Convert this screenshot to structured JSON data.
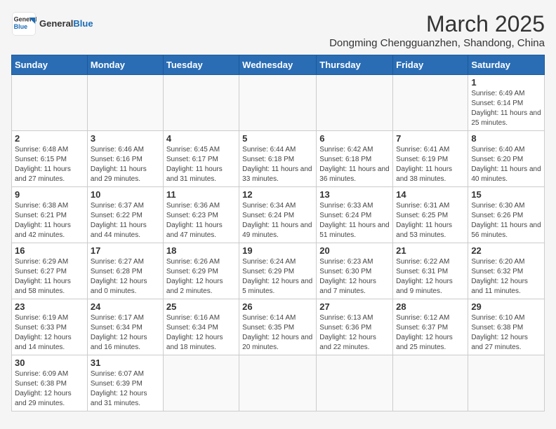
{
  "logo": {
    "line1": "General",
    "line2": "Blue"
  },
  "title": "March 2025",
  "location": "Dongming Chengguanzhen, Shandong, China",
  "headers": [
    "Sunday",
    "Monday",
    "Tuesday",
    "Wednesday",
    "Thursday",
    "Friday",
    "Saturday"
  ],
  "weeks": [
    [
      {
        "day": "",
        "info": ""
      },
      {
        "day": "",
        "info": ""
      },
      {
        "day": "",
        "info": ""
      },
      {
        "day": "",
        "info": ""
      },
      {
        "day": "",
        "info": ""
      },
      {
        "day": "",
        "info": ""
      },
      {
        "day": "1",
        "info": "Sunrise: 6:49 AM\nSunset: 6:14 PM\nDaylight: 11 hours and 25 minutes."
      }
    ],
    [
      {
        "day": "2",
        "info": "Sunrise: 6:48 AM\nSunset: 6:15 PM\nDaylight: 11 hours and 27 minutes."
      },
      {
        "day": "3",
        "info": "Sunrise: 6:46 AM\nSunset: 6:16 PM\nDaylight: 11 hours and 29 minutes."
      },
      {
        "day": "4",
        "info": "Sunrise: 6:45 AM\nSunset: 6:17 PM\nDaylight: 11 hours and 31 minutes."
      },
      {
        "day": "5",
        "info": "Sunrise: 6:44 AM\nSunset: 6:18 PM\nDaylight: 11 hours and 33 minutes."
      },
      {
        "day": "6",
        "info": "Sunrise: 6:42 AM\nSunset: 6:18 PM\nDaylight: 11 hours and 36 minutes."
      },
      {
        "day": "7",
        "info": "Sunrise: 6:41 AM\nSunset: 6:19 PM\nDaylight: 11 hours and 38 minutes."
      },
      {
        "day": "8",
        "info": "Sunrise: 6:40 AM\nSunset: 6:20 PM\nDaylight: 11 hours and 40 minutes."
      }
    ],
    [
      {
        "day": "9",
        "info": "Sunrise: 6:38 AM\nSunset: 6:21 PM\nDaylight: 11 hours and 42 minutes."
      },
      {
        "day": "10",
        "info": "Sunrise: 6:37 AM\nSunset: 6:22 PM\nDaylight: 11 hours and 44 minutes."
      },
      {
        "day": "11",
        "info": "Sunrise: 6:36 AM\nSunset: 6:23 PM\nDaylight: 11 hours and 47 minutes."
      },
      {
        "day": "12",
        "info": "Sunrise: 6:34 AM\nSunset: 6:24 PM\nDaylight: 11 hours and 49 minutes."
      },
      {
        "day": "13",
        "info": "Sunrise: 6:33 AM\nSunset: 6:24 PM\nDaylight: 11 hours and 51 minutes."
      },
      {
        "day": "14",
        "info": "Sunrise: 6:31 AM\nSunset: 6:25 PM\nDaylight: 11 hours and 53 minutes."
      },
      {
        "day": "15",
        "info": "Sunrise: 6:30 AM\nSunset: 6:26 PM\nDaylight: 11 hours and 56 minutes."
      }
    ],
    [
      {
        "day": "16",
        "info": "Sunrise: 6:29 AM\nSunset: 6:27 PM\nDaylight: 11 hours and 58 minutes."
      },
      {
        "day": "17",
        "info": "Sunrise: 6:27 AM\nSunset: 6:28 PM\nDaylight: 12 hours and 0 minutes."
      },
      {
        "day": "18",
        "info": "Sunrise: 6:26 AM\nSunset: 6:29 PM\nDaylight: 12 hours and 2 minutes."
      },
      {
        "day": "19",
        "info": "Sunrise: 6:24 AM\nSunset: 6:29 PM\nDaylight: 12 hours and 5 minutes."
      },
      {
        "day": "20",
        "info": "Sunrise: 6:23 AM\nSunset: 6:30 PM\nDaylight: 12 hours and 7 minutes."
      },
      {
        "day": "21",
        "info": "Sunrise: 6:22 AM\nSunset: 6:31 PM\nDaylight: 12 hours and 9 minutes."
      },
      {
        "day": "22",
        "info": "Sunrise: 6:20 AM\nSunset: 6:32 PM\nDaylight: 12 hours and 11 minutes."
      }
    ],
    [
      {
        "day": "23",
        "info": "Sunrise: 6:19 AM\nSunset: 6:33 PM\nDaylight: 12 hours and 14 minutes."
      },
      {
        "day": "24",
        "info": "Sunrise: 6:17 AM\nSunset: 6:34 PM\nDaylight: 12 hours and 16 minutes."
      },
      {
        "day": "25",
        "info": "Sunrise: 6:16 AM\nSunset: 6:34 PM\nDaylight: 12 hours and 18 minutes."
      },
      {
        "day": "26",
        "info": "Sunrise: 6:14 AM\nSunset: 6:35 PM\nDaylight: 12 hours and 20 minutes."
      },
      {
        "day": "27",
        "info": "Sunrise: 6:13 AM\nSunset: 6:36 PM\nDaylight: 12 hours and 22 minutes."
      },
      {
        "day": "28",
        "info": "Sunrise: 6:12 AM\nSunset: 6:37 PM\nDaylight: 12 hours and 25 minutes."
      },
      {
        "day": "29",
        "info": "Sunrise: 6:10 AM\nSunset: 6:38 PM\nDaylight: 12 hours and 27 minutes."
      }
    ],
    [
      {
        "day": "30",
        "info": "Sunrise: 6:09 AM\nSunset: 6:38 PM\nDaylight: 12 hours and 29 minutes."
      },
      {
        "day": "31",
        "info": "Sunrise: 6:07 AM\nSunset: 6:39 PM\nDaylight: 12 hours and 31 minutes."
      },
      {
        "day": "",
        "info": ""
      },
      {
        "day": "",
        "info": ""
      },
      {
        "day": "",
        "info": ""
      },
      {
        "day": "",
        "info": ""
      },
      {
        "day": "",
        "info": ""
      }
    ]
  ]
}
